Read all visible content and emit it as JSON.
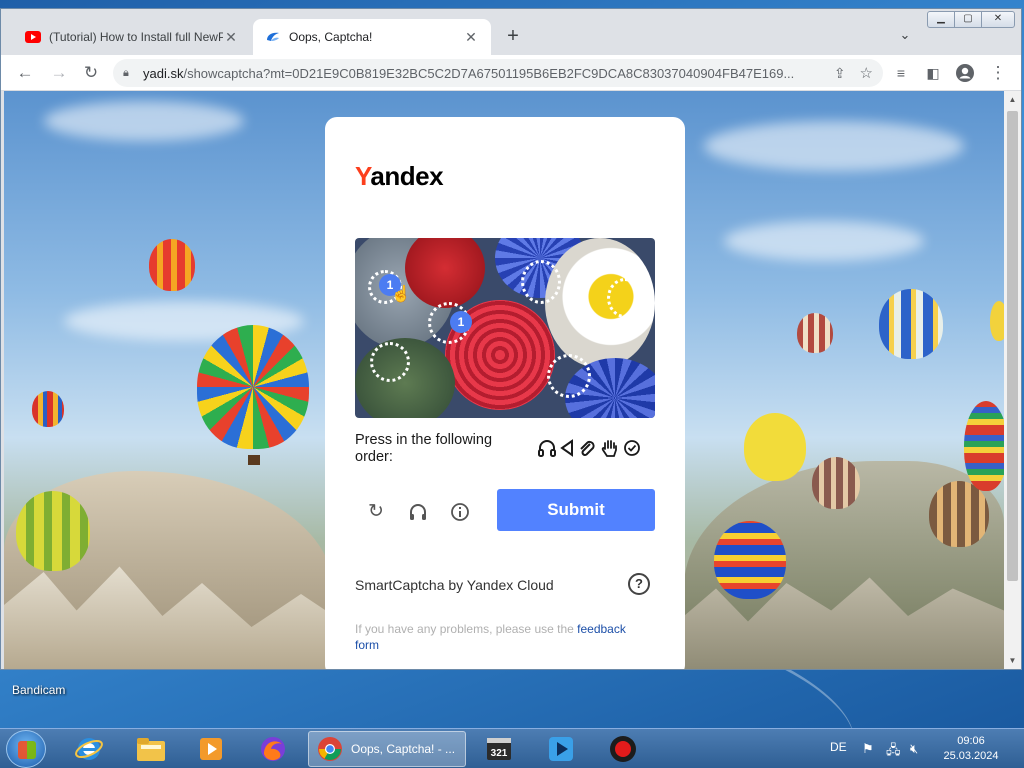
{
  "browser": {
    "tabs": [
      {
        "title": "(Tutorial) How to Install full NewP",
        "active": false,
        "favicon": "youtube-icon"
      },
      {
        "title": "Oops, Captcha!",
        "active": true,
        "favicon": "yandex-disk-icon"
      }
    ],
    "url_host": "yadi.sk",
    "url_rest": "/showcaptcha?mt=0D21E9C0B819E32BC5C2D7A67501195B6EB2FC9DCA8C83037040904FB47E169..."
  },
  "captcha": {
    "logo": "Yandex",
    "instruction": "Press in the following order:",
    "order_icons": [
      "headphones-icon",
      "play-back-icon",
      "paperclip-icon",
      "hand-icon",
      "check-circle-icon"
    ],
    "markers": [
      "1",
      "1"
    ],
    "submit_label": "Submit",
    "brand_line": "SmartCaptcha by Yandex Cloud",
    "help_symbol": "?",
    "feedback_prefix": "If you have any problems, please use the ",
    "feedback_link": "feedback",
    "feedback_suffix": "form"
  },
  "desktop": {
    "icon_label": "Bandicam"
  },
  "taskbar": {
    "chrome_label": "Oops, Captcha! - ...",
    "language": "DE",
    "time": "09:06",
    "date": "25.03.2024"
  },
  "colors": {
    "accent": "#5282ff",
    "yandex_red": "#fc3f1d",
    "link": "#1c4fa8"
  }
}
